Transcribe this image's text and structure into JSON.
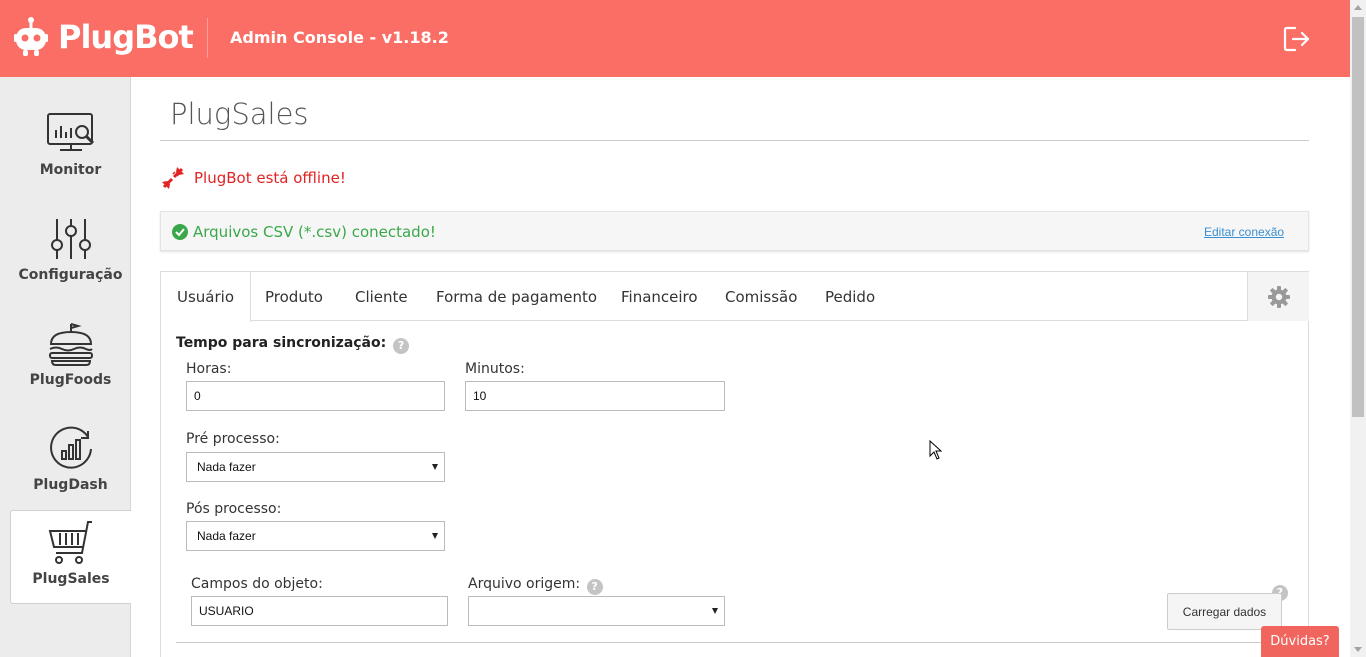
{
  "header": {
    "brand": "PlugBot",
    "console_title": "Admin Console - v1.18.2",
    "bg_color": "#fa6e66"
  },
  "sidebar": {
    "items": [
      {
        "label": "Monitor",
        "icon": "monitor-chart-icon"
      },
      {
        "label": "Configuração",
        "icon": "sliders-icon"
      },
      {
        "label": "PlugFoods",
        "icon": "burger-icon"
      },
      {
        "label": "PlugDash",
        "icon": "dashboard-chart-icon"
      },
      {
        "label": "PlugSales",
        "icon": "shopping-cart-icon",
        "active": true
      }
    ]
  },
  "page": {
    "title": "PlugSales",
    "offline_message": "PlugBot está offline!",
    "connection_message": "Arquivos CSV (*.csv) conectado!",
    "edit_connection": "Editar conexão"
  },
  "tabs": [
    {
      "label": "Usuário",
      "active": true
    },
    {
      "label": "Produto"
    },
    {
      "label": "Cliente"
    },
    {
      "label": "Forma de pagamento"
    },
    {
      "label": "Financeiro"
    },
    {
      "label": "Comissão"
    },
    {
      "label": "Pedido"
    }
  ],
  "form": {
    "sync_label": "Tempo para sincronização:",
    "help_glyph": "?",
    "hours_label": "Horas:",
    "hours_value": "0",
    "minutes_label": "Minutos:",
    "minutes_value": "10",
    "pre_label": "Pré processo:",
    "pre_value": "Nada fazer",
    "post_label": "Pós processo:",
    "post_value": "Nada fazer",
    "fields_label": "Campos do objeto:",
    "fields_value": "USUARIO",
    "source_label": "Arquivo origem:",
    "source_value": "",
    "load_button": "Carregar dados"
  },
  "help_widget": {
    "label": "Dúvidas?"
  },
  "colors": {
    "accent": "#fa6e66",
    "error": "#e02424",
    "success": "#3aa84a",
    "link": "#3a8fd0"
  }
}
